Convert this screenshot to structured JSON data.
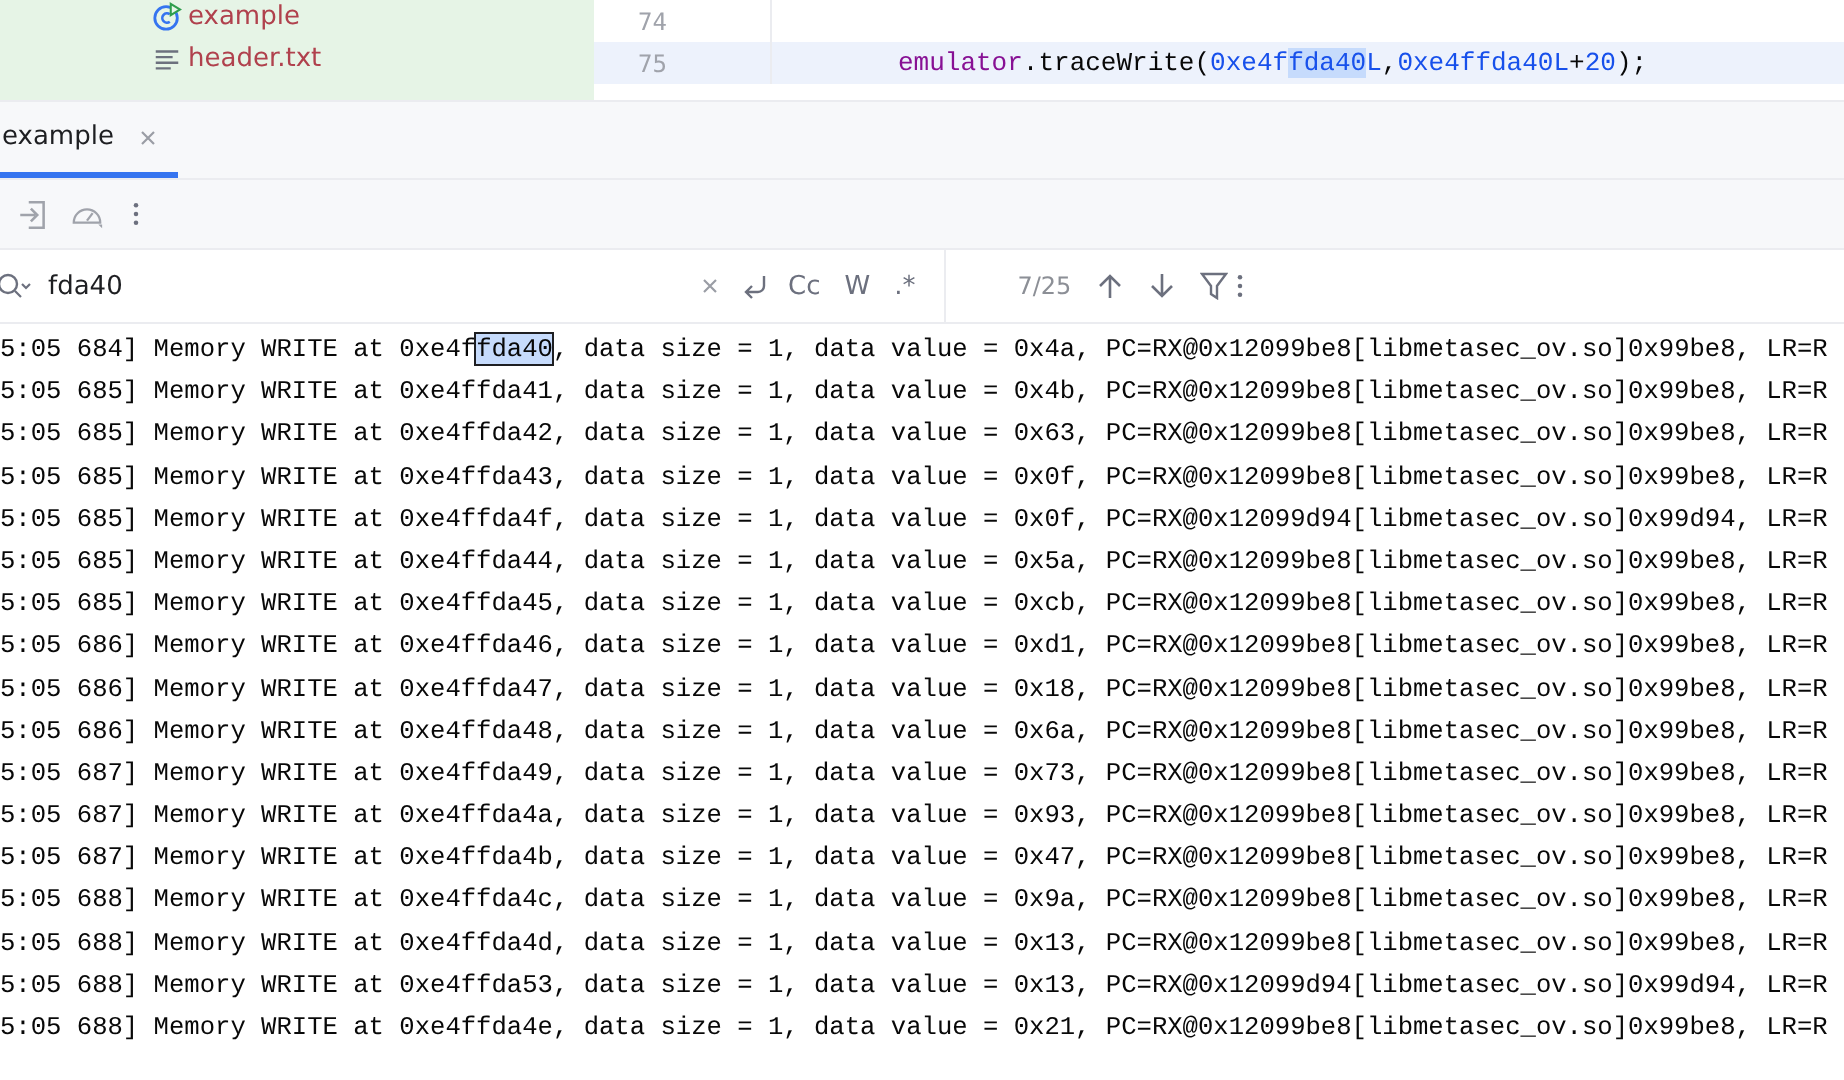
{
  "project_tree": {
    "items": [
      {
        "label": "example",
        "kind": "class"
      },
      {
        "label": "header.txt",
        "kind": "text"
      }
    ]
  },
  "editor": {
    "lines": [
      {
        "number": "74",
        "current": false
      },
      {
        "number": "75",
        "current": true,
        "tokens": [
          {
            "text": "emulator",
            "kind": "field"
          },
          {
            "text": ".traceWrite(",
            "kind": "plain"
          },
          {
            "text": "0xe4f",
            "kind": "number"
          },
          {
            "text": "fda40",
            "kind": "match"
          },
          {
            "text": "L",
            "kind": "number"
          },
          {
            "text": ",",
            "kind": "plain"
          },
          {
            "text": "0xe4ffda40L",
            "kind": "number"
          },
          {
            "text": "+",
            "kind": "plain"
          },
          {
            "text": "20",
            "kind": "number"
          },
          {
            "text": ");",
            "kind": "plain"
          }
        ]
      }
    ]
  },
  "run_panel": {
    "tabs": [
      {
        "label": "example",
        "selected": true
      }
    ],
    "search": {
      "value": "fda40",
      "match_count": "7/25",
      "toggles": [
        {
          "label": "Cc",
          "kind": "text"
        },
        {
          "label": "W",
          "kind": "text"
        },
        {
          "label": ".*",
          "kind": "text"
        }
      ]
    },
    "log": [
      {
        "before": "5:05 684] Memory WRITE at 0xe4f",
        "match": "fda40",
        "after": ", data size = 1, data value = 0x4a, PC=RX@0x12099be8[libmetasec_ov.so]0x99be8, LR=R"
      },
      {
        "text": "5:05 685] Memory WRITE at 0xe4ffda41, data size = 1, data value = 0x4b, PC=RX@0x12099be8[libmetasec_ov.so]0x99be8, LR=R"
      },
      {
        "text": "5:05 685] Memory WRITE at 0xe4ffda42, data size = 1, data value = 0x63, PC=RX@0x12099be8[libmetasec_ov.so]0x99be8, LR=R"
      },
      {
        "text": "5:05 685] Memory WRITE at 0xe4ffda43, data size = 1, data value = 0x0f, PC=RX@0x12099be8[libmetasec_ov.so]0x99be8, LR=R"
      },
      {
        "text": "5:05 685] Memory WRITE at 0xe4ffda4f, data size = 1, data value = 0x0f, PC=RX@0x12099d94[libmetasec_ov.so]0x99d94, LR=R"
      },
      {
        "text": "5:05 685] Memory WRITE at 0xe4ffda44, data size = 1, data value = 0x5a, PC=RX@0x12099be8[libmetasec_ov.so]0x99be8, LR=R"
      },
      {
        "text": "5:05 685] Memory WRITE at 0xe4ffda45, data size = 1, data value = 0xcb, PC=RX@0x12099be8[libmetasec_ov.so]0x99be8, LR=R"
      },
      {
        "text": "5:05 686] Memory WRITE at 0xe4ffda46, data size = 1, data value = 0xd1, PC=RX@0x12099be8[libmetasec_ov.so]0x99be8, LR=R"
      },
      {
        "text": "5:05 686] Memory WRITE at 0xe4ffda47, data size = 1, data value = 0x18, PC=RX@0x12099be8[libmetasec_ov.so]0x99be8, LR=R"
      },
      {
        "text": "5:05 686] Memory WRITE at 0xe4ffda48, data size = 1, data value = 0x6a, PC=RX@0x12099be8[libmetasec_ov.so]0x99be8, LR=R"
      },
      {
        "text": "5:05 687] Memory WRITE at 0xe4ffda49, data size = 1, data value = 0x73, PC=RX@0x12099be8[libmetasec_ov.so]0x99be8, LR=R"
      },
      {
        "text": "5:05 687] Memory WRITE at 0xe4ffda4a, data size = 1, data value = 0x93, PC=RX@0x12099be8[libmetasec_ov.so]0x99be8, LR=R"
      },
      {
        "text": "5:05 687] Memory WRITE at 0xe4ffda4b, data size = 1, data value = 0x47, PC=RX@0x12099be8[libmetasec_ov.so]0x99be8, LR=R"
      },
      {
        "text": "5:05 688] Memory WRITE at 0xe4ffda4c, data size = 1, data value = 0x9a, PC=RX@0x12099be8[libmetasec_ov.so]0x99be8, LR=R"
      },
      {
        "text": "5:05 688] Memory WRITE at 0xe4ffda4d, data size = 1, data value = 0x13, PC=RX@0x12099be8[libmetasec_ov.so]0x99be8, LR=R"
      },
      {
        "text": "5:05 688] Memory WRITE at 0xe4ffda53, data size = 1, data value = 0x13, PC=RX@0x12099d94[libmetasec_ov.so]0x99d94, LR=R"
      },
      {
        "text": "5:05 688] Memory WRITE at 0xe4ffda4e, data size = 1, data value = 0x21, PC=RX@0x12099be8[libmetasec_ov.so]0x99be8, LR=R"
      }
    ]
  }
}
